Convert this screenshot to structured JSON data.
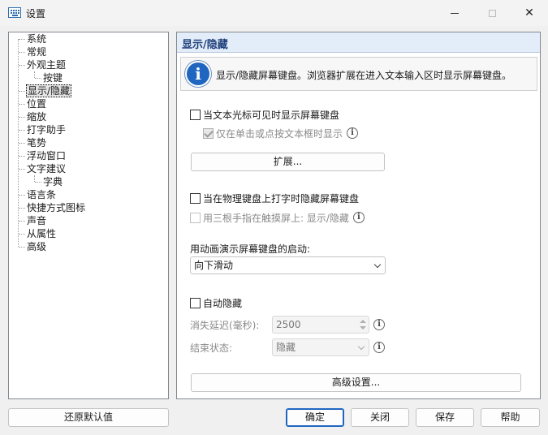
{
  "window": {
    "title": "设置",
    "icon": "keyboard-icon",
    "controls": {
      "minimize": "minimize-icon",
      "maximize": "maximize-icon",
      "close": "✕"
    }
  },
  "tree": {
    "items": [
      {
        "label": "系统",
        "level": 0
      },
      {
        "label": "常规",
        "level": 0
      },
      {
        "label": "外观主题",
        "level": 0
      },
      {
        "label": "按键",
        "level": 1
      },
      {
        "label": "显示/隐藏",
        "level": 0,
        "selected": true
      },
      {
        "label": "位置",
        "level": 0
      },
      {
        "label": "缩放",
        "level": 0
      },
      {
        "label": "打字助手",
        "level": 0
      },
      {
        "label": "笔势",
        "level": 0
      },
      {
        "label": "浮动窗口",
        "level": 0
      },
      {
        "label": "文字建议",
        "level": 0
      },
      {
        "label": "字典",
        "level": 1
      },
      {
        "label": "语言条",
        "level": 0
      },
      {
        "label": "快捷方式图标",
        "level": 0
      },
      {
        "label": "声音",
        "level": 0
      },
      {
        "label": "从属性",
        "level": 0
      },
      {
        "label": "高级",
        "level": 0
      }
    ]
  },
  "panel": {
    "title": "显示/隐藏",
    "info_icon": "i",
    "info_text": "显示/隐藏屏幕键盘。浏览器扩展在进入文本输入区时显示屏幕键盘。",
    "show_when_caret": "当文本光标可见时显示屏幕键盘",
    "only_on_click": "仅在单击或点按文本框时显示",
    "extensions_button": "扩展...",
    "hide_when_typing": "当在物理键盘上打字时隐藏屏幕键盘",
    "three_finger": "用三根手指在触摸屏上: 显示/隐藏",
    "animate_label": "用动画演示屏幕键盘的启动:",
    "animate_value": "向下滑动",
    "auto_hide": "自动隐藏",
    "delay_label": "消失延迟(毫秒):",
    "delay_value": "2500",
    "end_state_label": "结束状态:",
    "end_state_value": "隐藏",
    "advanced_button": "高级设置...",
    "help_icon": "i"
  },
  "footer": {
    "restore": "还原默认值",
    "ok": "确定",
    "close": "关闭",
    "save": "保存",
    "help": "帮助"
  }
}
